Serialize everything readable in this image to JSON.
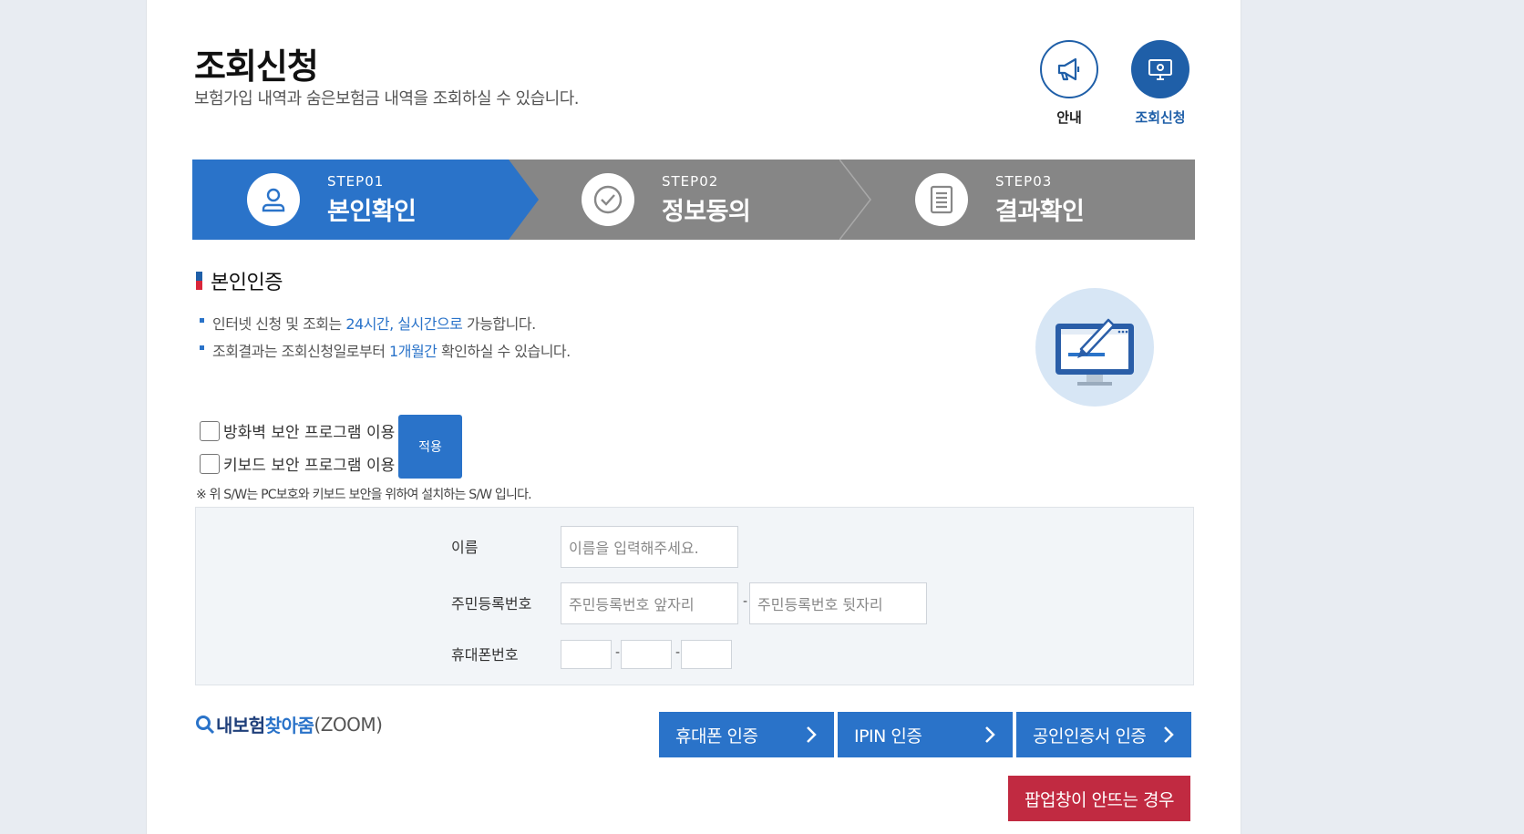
{
  "header": {
    "title": "조회신청",
    "subtitle": "보험가입 내역과 숨은보험금 내역을 조회하실 수 있습니다."
  },
  "quick_nav": [
    {
      "label": "안내",
      "icon": "megaphone-icon"
    },
    {
      "label": "조회신청",
      "icon": "monitor-icon"
    }
  ],
  "steps": [
    {
      "number": "STEP01",
      "name": "본인확인",
      "icon": "user-icon",
      "active": true
    },
    {
      "number": "STEP02",
      "name": "정보동의",
      "icon": "check-circle-icon",
      "active": false
    },
    {
      "number": "STEP03",
      "name": "결과확인",
      "icon": "document-icon",
      "active": false
    }
  ],
  "section": {
    "title": "본인인증",
    "bullet1": {
      "pre": "인터넷 신청 및 조회는 ",
      "hl": "24시간, 실시간으로",
      "post": " 가능합니다."
    },
    "bullet2": {
      "pre": "조회결과는 조회신청일로부터 ",
      "hl": "1개월간",
      "post": " 확인하실 수 있습니다."
    }
  },
  "security": {
    "firewall_label": "방화벽 보안 프로그램 이용",
    "keyboard_label": "키보드 보안 프로그램 이용",
    "apply_label": "적용",
    "note": "※ 위 S/W는 PC보호와 키보드 보안을 위하여 설치하는 S/W 입니다."
  },
  "form": {
    "name_label": "이름",
    "name_placeholder": "이름을 입력해주세요.",
    "rrn_label": "주민등록번호",
    "rrn_front_placeholder": "주민등록번호 앞자리",
    "rrn_back_placeholder": "주민등록번호 뒷자리",
    "phone_label": "휴대폰번호",
    "dash": "-"
  },
  "zoom_logo": {
    "part1": "내보험 ",
    "part2": "찾아줌",
    "part3": "(ZOOM)"
  },
  "buttons": {
    "phone_auth": "휴대폰 인증",
    "ipin_auth": "IPIN 인증",
    "cert_auth": "공인인증서 인증",
    "popup": "팝업창이 안뜨는 경우"
  },
  "colors": {
    "primary": "#2a73c9",
    "navy": "#1f5fa8",
    "step_inactive": "#868686",
    "danger": "#c12a41"
  }
}
